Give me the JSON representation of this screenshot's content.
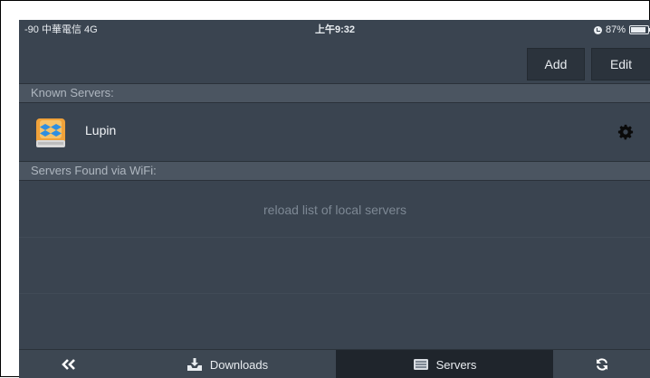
{
  "status_bar": {
    "carrier": "-90 中華電信  4G",
    "time": "上午9:32",
    "battery_text": "87%",
    "battery_level": 0.87
  },
  "toolbar": {
    "add_label": "Add",
    "edit_label": "Edit"
  },
  "known_servers": {
    "header": "Known Servers:",
    "items": [
      {
        "name": "Lupin",
        "icon": "dropbox-drive-icon",
        "settings_icon": "gear-icon"
      }
    ]
  },
  "wifi_servers": {
    "header": "Servers Found via WiFi:",
    "reload_text": "reload list of local servers"
  },
  "tabbar": {
    "back_icon": "double-chevron-left-icon",
    "downloads_label": "Downloads",
    "servers_label": "Servers",
    "reload_icon": "refresh-icon",
    "selected": "Servers"
  },
  "colors": {
    "background": "#3a4450",
    "section_header": "#4b5561",
    "selected_tab": "#1f252c",
    "text_primary": "#f1f4f7",
    "text_muted": "#7d8894"
  }
}
